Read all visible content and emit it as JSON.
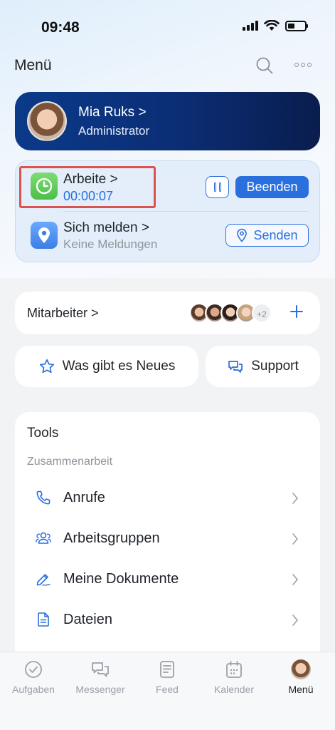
{
  "status_bar": {
    "time": "09:48"
  },
  "header": {
    "title": "Menü"
  },
  "profile": {
    "name": "Mia Ruks >",
    "role": "Administrator"
  },
  "time_tracking": {
    "work_title": "Arbeite >",
    "work_timer": "00:00:07",
    "end_label": "Beenden",
    "report_title": "Sich melden >",
    "report_sub": "Keine Meldungen",
    "send_label": "Senden"
  },
  "employees": {
    "label": "Mitarbeiter >",
    "more_count": "+2"
  },
  "quick": {
    "news_label": "Was gibt es Neues",
    "support_label": "Support"
  },
  "tools": {
    "title": "Tools",
    "section": "Zusammenarbeit",
    "items": [
      {
        "label": "Anrufe",
        "icon": "phone-icon"
      },
      {
        "label": "Arbeitsgruppen",
        "icon": "group-icon"
      },
      {
        "label": "Meine Dokumente",
        "icon": "pen-icon"
      },
      {
        "label": "Dateien",
        "icon": "file-icon"
      }
    ]
  },
  "tabbar": {
    "items": [
      {
        "label": "Aufgaben",
        "icon": "check-circle-icon"
      },
      {
        "label": "Messenger",
        "icon": "chat-icon"
      },
      {
        "label": "Feed",
        "icon": "feed-icon"
      },
      {
        "label": "Kalender",
        "icon": "calendar-icon"
      },
      {
        "label": "Menü",
        "icon": "avatar"
      }
    ],
    "active": "Menü"
  },
  "colors": {
    "accent": "#2a6fde",
    "profile_bg": "#0b2d74",
    "highlight": "#d9534f"
  }
}
